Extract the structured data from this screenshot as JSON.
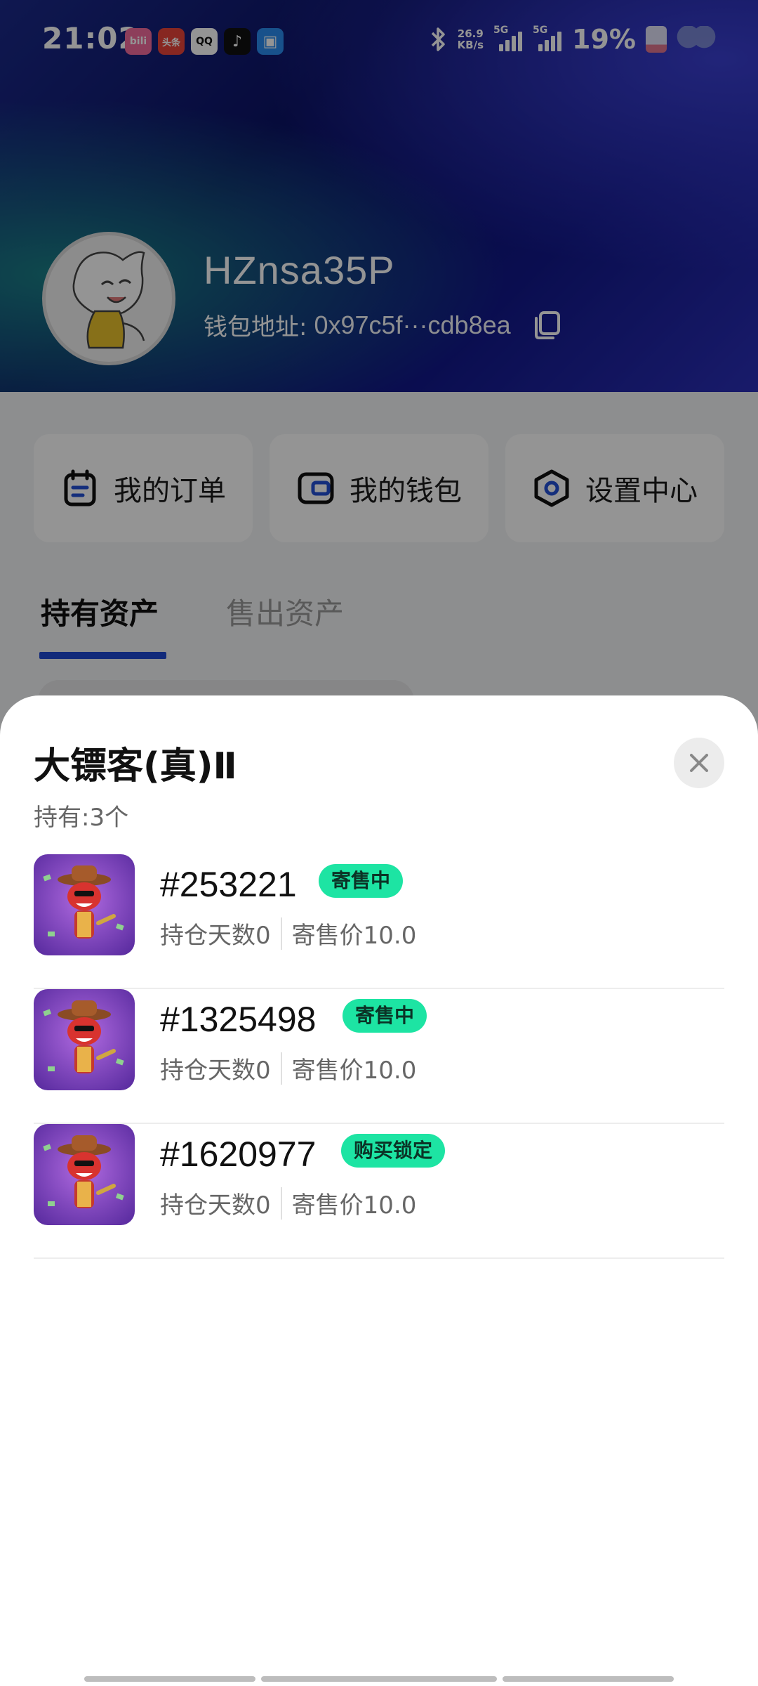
{
  "status_bar": {
    "time": "21:02",
    "apps": [
      {
        "name": "bilibili-app-icon",
        "label": "bili",
        "color": "#f36b9d"
      },
      {
        "name": "toutiao-app-icon",
        "label": "头条",
        "color": "#e8443a"
      },
      {
        "name": "qq-app-icon",
        "label": "QQ",
        "color": "#ffffff"
      },
      {
        "name": "douyin-app-icon",
        "label": "♪",
        "color": "#111111"
      },
      {
        "name": "blue-app-icon",
        "label": "▣",
        "color": "#2a8cf0"
      }
    ],
    "net_speed_value": "26.9",
    "net_speed_unit": "KB/s",
    "signal1_label": "5G",
    "signal2_label": "5G",
    "battery_percent": "19%"
  },
  "profile": {
    "username": "HZnsa35P",
    "wallet_label": "钱包地址:",
    "wallet_address": "0x97c5f···cdb8ea"
  },
  "quick_actions": [
    {
      "label": "我的订单",
      "icon": "orders-icon"
    },
    {
      "label": "我的钱包",
      "icon": "wallet-icon"
    },
    {
      "label": "设置中心",
      "icon": "settings-icon"
    }
  ],
  "tabs": {
    "active": "持有资产",
    "inactive": "售出资产"
  },
  "sheet": {
    "title": "大镖客(真)Ⅱ",
    "holding": "持有:3个",
    "items": [
      {
        "id": "#253221",
        "status": "寄售中",
        "days": "持仓天数0",
        "price": "寄售价10.0"
      },
      {
        "id": "#1325498",
        "status": "寄售中",
        "days": "持仓天数0",
        "price": "寄售价10.0"
      },
      {
        "id": "#1620977",
        "status": "购买锁定",
        "days": "持仓天数0",
        "price": "寄售价10.0"
      }
    ]
  },
  "colors": {
    "accent": "#1f49d3",
    "badge": "#1de4a3"
  }
}
